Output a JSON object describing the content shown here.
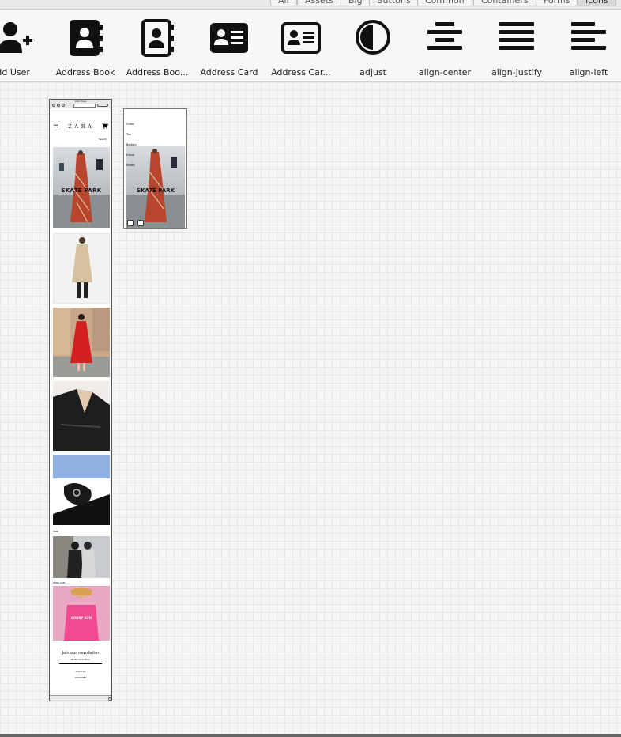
{
  "tabs": [
    "All",
    "Assets",
    "Big",
    "Buttons",
    "Common",
    "Containers",
    "Forms",
    "Icons"
  ],
  "active_tab": "Icons",
  "palette": {
    "items": [
      {
        "label": "Add User",
        "icon": "add-user-icon"
      },
      {
        "label": "Address Book",
        "icon": "address-book-icon"
      },
      {
        "label": "Address Boo...",
        "icon": "address-book-outline-icon"
      },
      {
        "label": "Address Card",
        "icon": "address-card-icon"
      },
      {
        "label": "Address Car...",
        "icon": "address-card-outline-icon"
      },
      {
        "label": "adjust",
        "icon": "adjust-icon"
      },
      {
        "label": "align-center",
        "icon": "align-center-icon"
      },
      {
        "label": "align-justify",
        "icon": "align-justify-icon"
      },
      {
        "label": "align-left",
        "icon": "align-left-icon"
      }
    ]
  },
  "phone": {
    "title": "Web Page",
    "brand": "ZARA",
    "search": "Search",
    "hero_text": "SKATE PARK",
    "sale_label": "Sale",
    "zara_label": "ZARA SUB",
    "shirt_text": "SORRY SUN",
    "newsletter_title": "Join our newsletter",
    "email_placeholder": "ENTER YOUR EMAIL",
    "twitter": "TWITTER",
    "youtube": "YOUTUBE"
  },
  "mockup2": {
    "menu": [
      "Outer",
      "Top",
      "Bottom",
      "Dress",
      "Shoes"
    ],
    "hero_text": "SKATE PARK"
  },
  "colors": {
    "canvas": "#f5f5f5",
    "icon": "#111111",
    "hero_dress": "#b8452e",
    "red_dress": "#d42020",
    "pink_bg": "#e8a8c4"
  }
}
